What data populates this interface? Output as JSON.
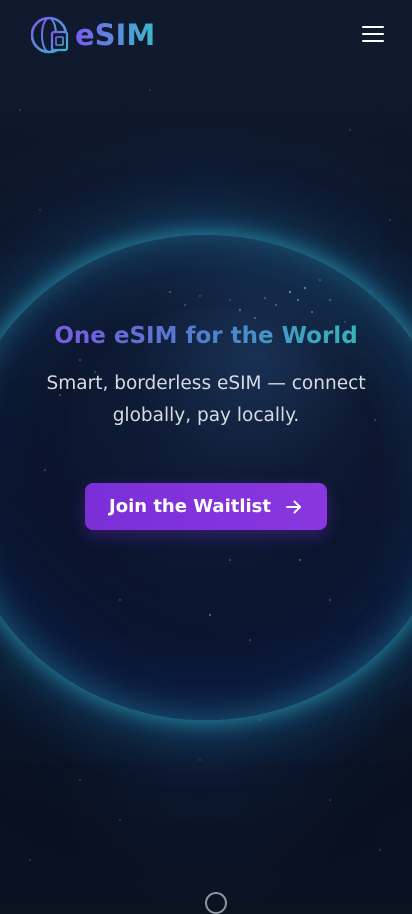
{
  "brand": {
    "name": "eSIM",
    "colors": {
      "gradient_start": "#7b5cf0",
      "gradient_end": "#3bb8c8"
    }
  },
  "header": {
    "logo_icon": "globe-sim-icon",
    "menu_icon": "hamburger-menu-icon"
  },
  "hero": {
    "title": "One eSIM for the World",
    "subtitle": "Smart, borderless eSIM — connect globally, pay locally.",
    "cta_label": "Join the Waitlist",
    "cta_icon": "arrow-right-icon",
    "cta_color": "#7a2fd6"
  },
  "footer": {
    "scroll_icon": "scroll-down-indicator"
  }
}
